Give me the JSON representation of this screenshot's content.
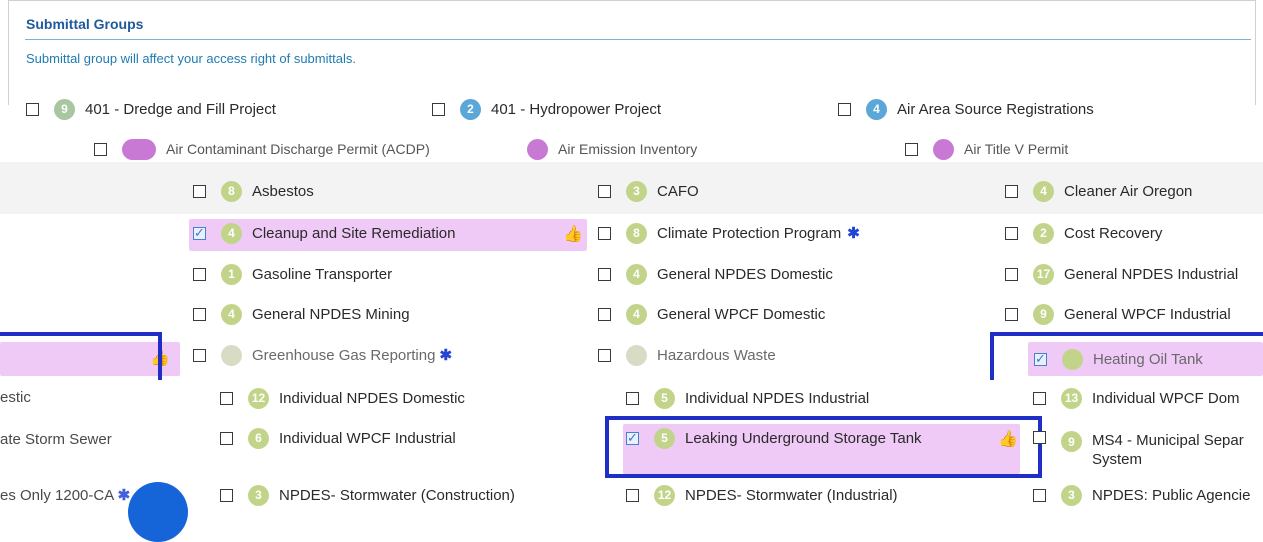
{
  "panel": {
    "title": "Submittal Groups",
    "subtitle": "Submittal group will affect your access right of submittals."
  },
  "top_row": [
    {
      "count": "9",
      "label": "401 - Dredge and Fill Project",
      "checked": false
    },
    {
      "count": "2",
      "label": "401 - Hydropower Project",
      "checked": false
    },
    {
      "count": "4",
      "label": "Air Area Source Registrations",
      "checked": false
    }
  ],
  "overlap_text": {
    "left": "Air Contaminant Discharge Permit (ACDP)",
    "middle": "Air Emission Inventory",
    "right": "Air Title V Permit"
  },
  "grid": [
    [
      {
        "count": "8",
        "label": "Asbestos",
        "checked": false
      },
      {
        "count": "3",
        "label": "CAFO",
        "checked": false
      },
      {
        "count": "4",
        "label": "Cleaner Air Oregon",
        "checked": false
      }
    ],
    [
      {
        "count": "4",
        "label": "Cleanup and Site Remediation",
        "checked": true,
        "starred": false,
        "liked": true
      },
      {
        "count": "8",
        "label": "Climate Protection Program",
        "checked": false,
        "starred": true
      },
      {
        "count": "2",
        "label": "Cost Recovery",
        "checked": false
      }
    ],
    [
      {
        "count": "1",
        "label": "Gasoline Transporter",
        "checked": false
      },
      {
        "count": "4",
        "label": "General NPDES Domestic",
        "checked": false
      },
      {
        "count": "17",
        "label": "General NPDES Industrial",
        "checked": false
      }
    ],
    [
      {
        "count": "4",
        "label": "General NPDES Mining",
        "checked": false
      },
      {
        "count": "4",
        "label": "General WPCF Domestic",
        "checked": false
      },
      {
        "count": "9",
        "label": "General WPCF Industrial",
        "checked": false
      }
    ]
  ],
  "garbled_row": {
    "left": "Greenhouse Gas Reporting",
    "middle": "Hazardous Waste",
    "right": "Heating Oil Tank"
  },
  "shifted_grid": [
    [
      {
        "count": "12",
        "label": "Individual NPDES Domestic",
        "checked": false
      },
      {
        "count": "5",
        "label": "Individual NPDES Industrial",
        "checked": false
      },
      {
        "count": "13",
        "label": "Individual WPCF Dom",
        "checked": false
      }
    ],
    [
      {
        "count": "6",
        "label": "Individual WPCF Industrial",
        "checked": false
      },
      {
        "count": "5",
        "label": "Leaking Underground Storage Tank",
        "checked": true,
        "liked": true
      },
      {
        "count": "9",
        "label": "MS4 - Municipal Separ",
        "label2": "System",
        "checked": false
      }
    ],
    [
      {
        "count": "3",
        "label": "NPDES- Stormwater (Construction)",
        "checked": false
      },
      {
        "count": "12",
        "label": "NPDES- Stormwater (Industrial)",
        "checked": false
      },
      {
        "count": "3",
        "label": "NPDES: Public Agencie",
        "checked": false
      }
    ]
  ],
  "left_fragments": [
    "estic",
    "ate Storm Sewer",
    "es Only 1200-CA"
  ],
  "colors": {
    "accent": "#1f5a9c",
    "highlight": "#efcaf6",
    "frame": "#1f2fc6",
    "badge": "#c2d48a"
  }
}
